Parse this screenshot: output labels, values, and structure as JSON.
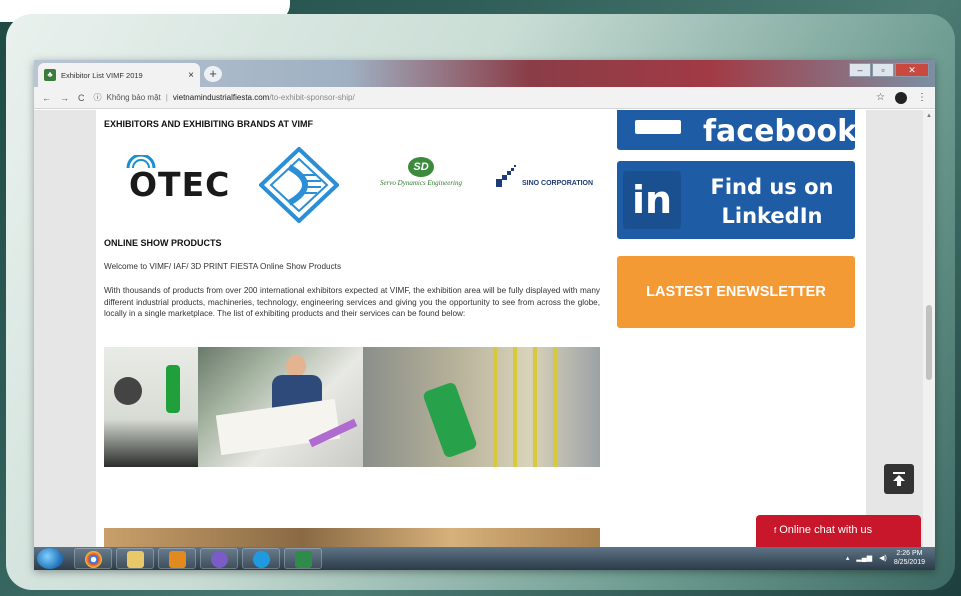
{
  "browser": {
    "tab_title": "Exhibitor List VIMF 2019",
    "tab_close": "×",
    "new_tab": "+",
    "url_secure_label": "Không bảo mật",
    "url_host": "vietnamindustrialfiesta.com",
    "url_path": "/to-exhibit-sponsor-ship/",
    "back": "←",
    "forward": "→",
    "reload": "C",
    "info": "ⓘ",
    "star": "☆",
    "menu": "⋮"
  },
  "page": {
    "exhibitors_heading": "EXHIBITORS AND EXHIBITING BRANDS AT VIMF",
    "logos": {
      "otec": "OTEC",
      "sd_mark": "SD",
      "sd_name": "Servo Dynamics Engineering",
      "sino": "SINO CORPORATION"
    },
    "products_heading": "ONLINE SHOW PRODUCTS",
    "welcome_text": "Welcome to VIMF/ IAF/ 3D PRINT FIESTA Online Show Products",
    "description": "With thousands of products from over 200 international exhibitors expected at VIMF, the exhibition area will be fully displayed with many different industrial products, machineries, technology, engineering services and giving you the opportunity to see from across the globe, locally in a single marketplace. The list of exhibiting products and their services can be found below:"
  },
  "sidebar": {
    "facebook_label": "facebook",
    "linkedin_badge": "in",
    "linkedin_label": "Find us on LinkedIn",
    "newsletter_label": "LASTEST ENEWSLETTER",
    "colors": {
      "social_blue": "#1f5ca6",
      "newsletter_orange": "#f39a34"
    }
  },
  "chat": {
    "label": "Online chat with us",
    "icon": "f",
    "color": "#c8162a"
  },
  "taskbar": {
    "time": "2:26 PM",
    "date": "8/25/2019",
    "apps": [
      "chrome-icon",
      "file-explorer-icon",
      "outlook-icon",
      "viber-icon",
      "skype-icon",
      "excel-icon"
    ]
  }
}
